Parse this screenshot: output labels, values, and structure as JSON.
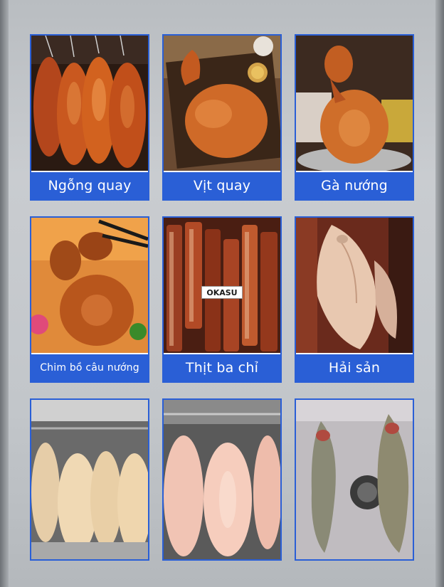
{
  "brand": {
    "logo_text": "OKASU"
  },
  "colors": {
    "label_bg": "#2a5fd6",
    "label_text": "#ffffff",
    "frame_bg": "#c4c8cc"
  },
  "tiles": [
    {
      "label": "Ngỗng quay",
      "photo": "roast-goose-icon"
    },
    {
      "label": "Vịt quay",
      "photo": "roast-duck-icon"
    },
    {
      "label": "Gà nướng",
      "photo": "roast-chicken-icon"
    },
    {
      "label": "Chim bồ câu nướng",
      "photo": "roast-pigeon-icon"
    },
    {
      "label": "Thịt ba chỉ",
      "photo": "pork-belly-icon"
    },
    {
      "label": "Hải sản",
      "photo": "dried-fish-icon"
    },
    {
      "label": "",
      "photo": "raw-duck-icon"
    },
    {
      "label": "",
      "photo": "raw-pork-icon"
    },
    {
      "label": "",
      "photo": "raw-fish-icon"
    }
  ]
}
